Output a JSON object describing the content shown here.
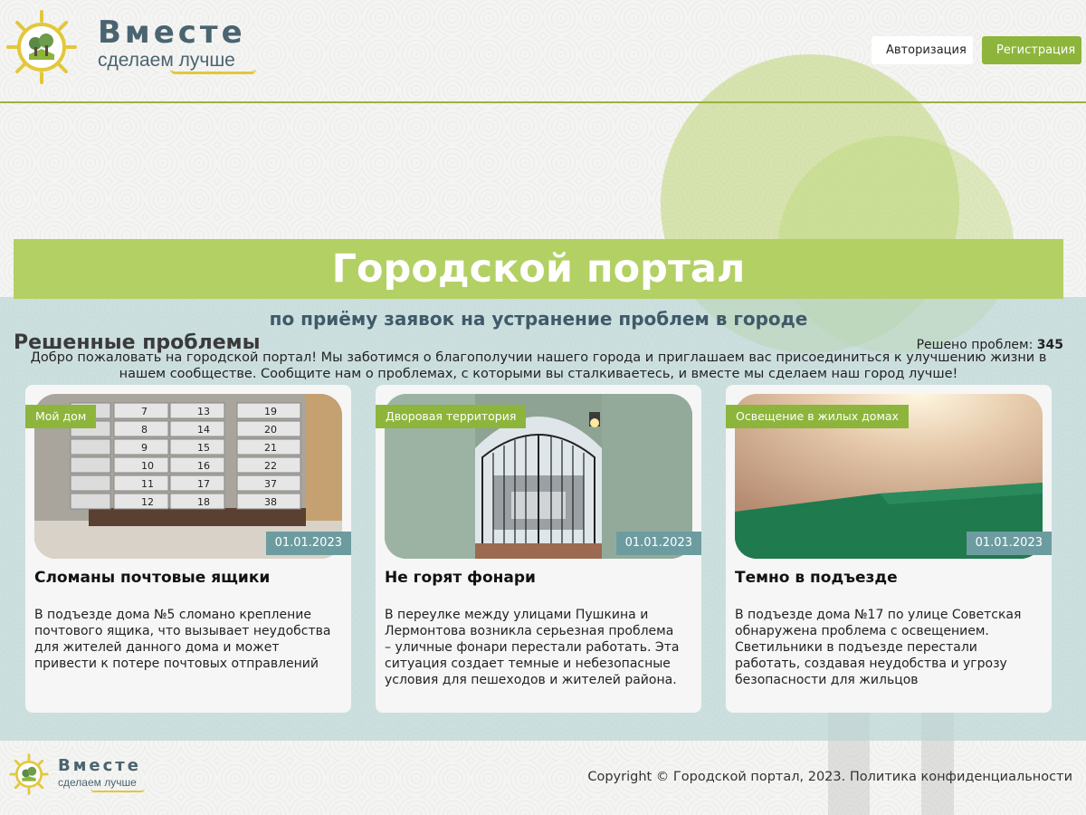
{
  "header": {
    "logo_title": "Вместе",
    "logo_subtitle": "сделаем лучше",
    "login_label": "Авторизация",
    "register_label": "Регистрация"
  },
  "hero": {
    "title": "Городской портал",
    "subtitle": "по приёму заявок на устранение проблем в городе",
    "intro": "Добро пожаловать на городской портал! Мы заботимся о благополучии нашего города и приглашаем вас присоединиться к улучшению жизни в нашем сообществе. Сообщите нам о проблемах, с которыми вы сталкиваетесь, и вместе мы сделаем наш город лучше!"
  },
  "solved": {
    "title": "Решенные проблемы",
    "count_label": "Решено проблем:",
    "count": "345",
    "cards": [
      {
        "tag": "Мой дом",
        "date": "01.01.2023",
        "title": "Сломаны почтовые ящики",
        "text": "В подъезде дома №5 сломано крепление почтового ящика, что вызывает неудобства для жителей данного дома и может привести к потере почтовых отправлений"
      },
      {
        "tag": "Дворовая территория",
        "date": "01.01.2023",
        "title": "Не горят фонари",
        "text": "В переулке между улицами Пушкина и Лермонтова возникла серьезная проблема – уличные фонари перестали работать. Эта ситуация создает темные и небезопасные условия для пешеходов и жителей района."
      },
      {
        "tag": "Освещение в жилых домах",
        "date": "01.01.2023",
        "title": "Темно в подъезде",
        "text": "В подъезде дома №17 по улице Советская обнаружена проблема с освещением. Светильники в подъезде перестали работать, создавая неудобства и угрозу безопасности для жильцов"
      }
    ],
    "mailbox_numbers": [
      "7",
      "13",
      "19",
      "8",
      "14",
      "20",
      "9",
      "15",
      "21",
      "10",
      "16",
      "22",
      "11",
      "17",
      "37",
      "12",
      "18",
      "38"
    ]
  },
  "footer": {
    "logo_title": "Вместе",
    "logo_subtitle": "сделаем лучше",
    "copyright": "Copyright © Городской портал, 2023. Политика конфиденциальности"
  },
  "colors": {
    "accent_green": "#8db53c",
    "banner_green": "#b3d064",
    "date_teal": "#6d9ca0",
    "text_slate": "#4a6470"
  }
}
